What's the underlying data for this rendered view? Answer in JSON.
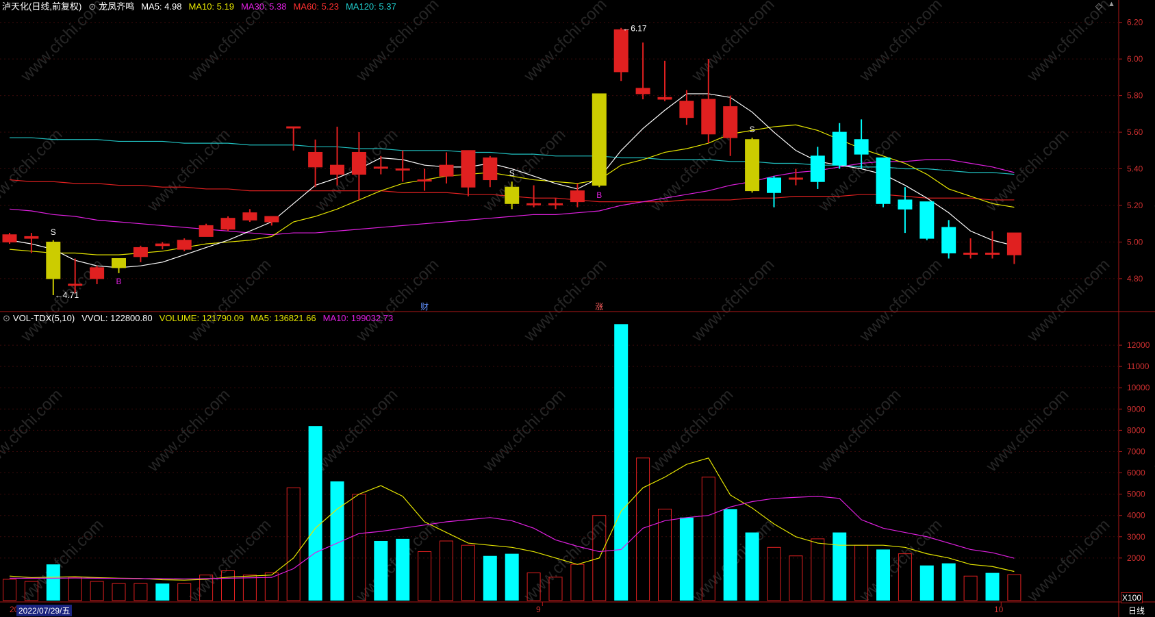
{
  "header": {
    "stock": "泸天化(日线,前复权)",
    "concept_icon": "circle-dot-icon",
    "concept": "龙凤齐鸣",
    "ma5": "MA5: 4.98",
    "ma10": "MA10: 5.19",
    "ma30": "MA30: 5.38",
    "ma60": "MA60: 5.23",
    "ma120": "MA120: 5.37"
  },
  "vol_header": {
    "name": "VOL-TDX(5,10)",
    "vvol": "VVOL: 122800.80",
    "volume": "VOLUME: 121790.09",
    "ma5": "MA5: 136821.66",
    "ma10": "MA10: 199032.73"
  },
  "footer": {
    "date_prefix": "20",
    "cursor_date": "2022/07/29/五",
    "month_9": "9",
    "month_10": "10",
    "period": "日线",
    "unit": "X100"
  },
  "watermark": "www.cfchi.com",
  "colors": {
    "up": "#e02020",
    "down": "#00ffff",
    "signal": "#cccc00",
    "ma5": "#ffffff",
    "ma10": "#e6e600",
    "ma30": "#e020e0",
    "ma60": "#e02020",
    "ma120": "#20c0c0",
    "axis": "#b01818"
  },
  "chart_data": [
    {
      "type": "candlestick",
      "title": "泸天化(日线,前复权)",
      "ylim": [
        4.62,
        6.24
      ],
      "yticks": [
        "6.20",
        "6.00",
        "5.80",
        "5.60",
        "5.40",
        "5.20",
        "5.00",
        "4.80"
      ],
      "candles": [
        {
          "o": 5.0,
          "c": 5.04,
          "h": 5.05,
          "l": 4.99
        },
        {
          "o": 5.02,
          "c": 5.03,
          "h": 5.05,
          "l": 4.94
        },
        {
          "o": 5.0,
          "c": 4.8,
          "h": 5.01,
          "l": 4.71,
          "hl": "signal"
        },
        {
          "o": 4.77,
          "c": 4.77,
          "h": 4.91,
          "l": 4.72
        },
        {
          "o": 4.8,
          "c": 4.86,
          "h": 4.87,
          "l": 4.77
        },
        {
          "o": 4.86,
          "c": 4.91,
          "h": 4.91,
          "l": 4.83,
          "hl": "signal"
        },
        {
          "o": 4.92,
          "c": 4.97,
          "h": 4.98,
          "l": 4.89
        },
        {
          "o": 4.98,
          "c": 4.99,
          "h": 5.0,
          "l": 4.96
        },
        {
          "o": 4.96,
          "c": 5.01,
          "h": 5.02,
          "l": 4.95
        },
        {
          "o": 5.03,
          "c": 5.09,
          "h": 5.1,
          "l": 5.03
        },
        {
          "o": 5.07,
          "c": 5.13,
          "h": 5.14,
          "l": 5.06
        },
        {
          "o": 5.12,
          "c": 5.16,
          "h": 5.18,
          "l": 5.11
        },
        {
          "o": 5.11,
          "c": 5.14,
          "h": 5.14,
          "l": 5.09
        },
        {
          "o": 5.63,
          "c": 5.63,
          "h": 5.63,
          "l": 5.5
        },
        {
          "o": 5.41,
          "c": 5.49,
          "h": 5.56,
          "l": 5.3
        },
        {
          "o": 5.37,
          "c": 5.42,
          "h": 5.63,
          "l": 5.31
        },
        {
          "o": 5.37,
          "c": 5.49,
          "h": 5.6,
          "l": 5.23
        },
        {
          "o": 5.41,
          "c": 5.41,
          "h": 5.47,
          "l": 5.37
        },
        {
          "o": 5.4,
          "c": 5.4,
          "h": 5.5,
          "l": 5.33
        },
        {
          "o": 5.34,
          "c": 5.34,
          "h": 5.4,
          "l": 5.28
        },
        {
          "o": 5.36,
          "c": 5.42,
          "h": 5.49,
          "l": 5.32
        },
        {
          "o": 5.3,
          "c": 5.5,
          "h": 5.5,
          "l": 5.25
        },
        {
          "o": 5.34,
          "c": 5.46,
          "h": 5.47,
          "l": 5.3
        },
        {
          "o": 5.3,
          "c": 5.21,
          "h": 5.33,
          "l": 5.18,
          "hl": "signal"
        },
        {
          "o": 5.21,
          "c": 5.21,
          "h": 5.31,
          "l": 5.19
        },
        {
          "o": 5.21,
          "c": 5.21,
          "h": 5.24,
          "l": 5.18
        },
        {
          "o": 5.22,
          "c": 5.28,
          "h": 5.32,
          "l": 5.19
        },
        {
          "o": 5.31,
          "c": 5.81,
          "h": 5.81,
          "l": 5.3,
          "hl": "signal"
        },
        {
          "o": 5.93,
          "c": 6.16,
          "h": 6.17,
          "l": 5.88
        },
        {
          "o": 5.81,
          "c": 5.84,
          "h": 6.09,
          "l": 5.78
        },
        {
          "o": 5.78,
          "c": 5.79,
          "h": 5.99,
          "l": 5.77
        },
        {
          "o": 5.68,
          "c": 5.77,
          "h": 5.83,
          "l": 5.64
        },
        {
          "o": 5.59,
          "c": 5.78,
          "h": 6.0,
          "l": 5.54
        },
        {
          "o": 5.57,
          "c": 5.74,
          "h": 5.8,
          "l": 5.47
        },
        {
          "o": 5.56,
          "c": 5.28,
          "h": 5.57,
          "l": 5.27,
          "hl": "signal"
        },
        {
          "o": 5.35,
          "c": 5.27,
          "h": 5.36,
          "l": 5.19
        },
        {
          "o": 5.35,
          "c": 5.35,
          "h": 5.4,
          "l": 5.31
        },
        {
          "o": 5.47,
          "c": 5.33,
          "h": 5.52,
          "l": 5.29
        },
        {
          "o": 5.6,
          "c": 5.42,
          "h": 5.65,
          "l": 5.4
        },
        {
          "o": 5.56,
          "c": 5.48,
          "h": 5.67,
          "l": 5.4
        },
        {
          "o": 5.46,
          "c": 5.21,
          "h": 5.46,
          "l": 5.19
        },
        {
          "o": 5.23,
          "c": 5.18,
          "h": 5.3,
          "l": 5.05
        },
        {
          "o": 5.22,
          "c": 5.02,
          "h": 5.22,
          "l": 5.01
        },
        {
          "o": 5.08,
          "c": 4.94,
          "h": 5.12,
          "l": 4.91
        },
        {
          "o": 4.94,
          "c": 4.94,
          "h": 5.02,
          "l": 4.91
        },
        {
          "o": 4.94,
          "c": 4.94,
          "h": 5.06,
          "l": 4.91
        },
        {
          "o": 4.93,
          "c": 5.05,
          "h": 5.05,
          "l": 4.88
        }
      ],
      "ma5": [
        5.01,
        4.99,
        4.96,
        4.9,
        4.87,
        4.86,
        4.87,
        4.89,
        4.93,
        4.97,
        5.01,
        5.06,
        5.11,
        5.21,
        5.31,
        5.35,
        5.4,
        5.46,
        5.45,
        5.42,
        5.41,
        5.41,
        5.43,
        5.4,
        5.36,
        5.32,
        5.29,
        5.35,
        5.5,
        5.62,
        5.72,
        5.81,
        5.81,
        5.79,
        5.71,
        5.6,
        5.5,
        5.44,
        5.42,
        5.4,
        5.37,
        5.31,
        5.24,
        5.16,
        5.06,
        5.01,
        4.98
      ],
      "ma10": [
        4.96,
        4.95,
        4.94,
        4.94,
        4.93,
        4.93,
        4.94,
        4.95,
        4.97,
        4.99,
        5.0,
        5.01,
        5.03,
        5.11,
        5.14,
        5.18,
        5.23,
        5.28,
        5.32,
        5.34,
        5.36,
        5.37,
        5.38,
        5.36,
        5.34,
        5.33,
        5.32,
        5.34,
        5.42,
        5.45,
        5.49,
        5.51,
        5.54,
        5.59,
        5.61,
        5.63,
        5.64,
        5.61,
        5.56,
        5.51,
        5.47,
        5.43,
        5.37,
        5.29,
        5.25,
        5.21,
        5.19
      ],
      "ma30": [
        5.18,
        5.17,
        5.15,
        5.14,
        5.12,
        5.11,
        5.1,
        5.09,
        5.08,
        5.07,
        5.06,
        5.05,
        5.04,
        5.05,
        5.05,
        5.06,
        5.07,
        5.08,
        5.09,
        5.1,
        5.11,
        5.12,
        5.13,
        5.14,
        5.15,
        5.15,
        5.16,
        5.17,
        5.2,
        5.22,
        5.24,
        5.26,
        5.28,
        5.31,
        5.33,
        5.36,
        5.38,
        5.39,
        5.41,
        5.43,
        5.44,
        5.44,
        5.45,
        5.45,
        5.43,
        5.41,
        5.38
      ],
      "ma60": [
        5.34,
        5.33,
        5.33,
        5.32,
        5.32,
        5.31,
        5.31,
        5.3,
        5.3,
        5.29,
        5.29,
        5.28,
        5.28,
        5.28,
        5.28,
        5.28,
        5.28,
        5.28,
        5.27,
        5.27,
        5.27,
        5.26,
        5.26,
        5.25,
        5.24,
        5.24,
        5.23,
        5.22,
        5.22,
        5.22,
        5.22,
        5.23,
        5.23,
        5.23,
        5.24,
        5.24,
        5.25,
        5.25,
        5.25,
        5.26,
        5.26,
        5.25,
        5.24,
        5.24,
        5.24,
        5.23,
        5.23
      ],
      "ma120": [
        5.57,
        5.57,
        5.56,
        5.56,
        5.56,
        5.55,
        5.55,
        5.55,
        5.54,
        5.54,
        5.54,
        5.53,
        5.53,
        5.53,
        5.52,
        5.52,
        5.51,
        5.51,
        5.5,
        5.5,
        5.5,
        5.49,
        5.49,
        5.48,
        5.48,
        5.47,
        5.47,
        5.47,
        5.46,
        5.46,
        5.45,
        5.45,
        5.45,
        5.44,
        5.44,
        5.43,
        5.43,
        5.42,
        5.42,
        5.41,
        5.41,
        5.4,
        5.4,
        5.39,
        5.38,
        5.38,
        5.37
      ],
      "annotations": [
        {
          "i": 2,
          "text": "S",
          "pos": "above"
        },
        {
          "i": 5,
          "text": "B",
          "pos": "below"
        },
        {
          "i": 23,
          "text": "S",
          "pos": "above"
        },
        {
          "i": 27,
          "text": "B",
          "pos": "below"
        },
        {
          "i": 34,
          "text": "S",
          "pos": "above"
        },
        {
          "i": 2,
          "text": "←4.71",
          "pos": "low"
        },
        {
          "i": 28,
          "text": "←6.17",
          "pos": "high"
        }
      ],
      "markers": [
        {
          "i": 19,
          "text": "财"
        },
        {
          "i": 27,
          "text": "涨"
        }
      ]
    },
    {
      "type": "bar",
      "title": "VOL-TDX(5,10)",
      "unit": "X100",
      "ylim": [
        0,
        13000
      ],
      "yticks": [
        "12000",
        "11000",
        "10000",
        "9000",
        "8000",
        "7000",
        "6000",
        "5000",
        "4000",
        "3000",
        "2000"
      ],
      "series": [
        {
          "name": "VOLUME",
          "values": [
            1000,
            900,
            1700,
            1100,
            900,
            800,
            800,
            800,
            800,
            1200,
            1400,
            1200,
            1300,
            5300,
            8200,
            5600,
            5000,
            2800,
            2900,
            2300,
            2800,
            2600,
            2100,
            2200,
            1300,
            1100,
            1700,
            4000,
            12990,
            6700,
            4300,
            3900,
            5800,
            4300,
            3200,
            2500,
            2100,
            2900,
            3200,
            2600,
            2400,
            2200,
            1650,
            1750,
            1150,
            1300,
            1218
          ]
        },
        {
          "name": "MA5",
          "values": [
            1150,
            1080,
            1100,
            1120,
            1080,
            1050,
            1040,
            980,
            960,
            1000,
            1100,
            1150,
            1200,
            2000,
            3400,
            4300,
            5000,
            5400,
            4900,
            3700,
            3200,
            2700,
            2600,
            2500,
            2300,
            2000,
            1700,
            2000,
            4200,
            5300,
            5800,
            6400,
            6700,
            4960,
            4350,
            3600,
            3000,
            2700,
            2600,
            2600,
            2600,
            2500,
            2200,
            2000,
            1700,
            1600,
            1368
          ]
        },
        {
          "name": "MA10",
          "values": [
            1050,
            1050,
            1050,
            1060,
            1050,
            1040,
            1030,
            1030,
            1020,
            1030,
            1050,
            1070,
            1090,
            1500,
            2250,
            2700,
            3150,
            3250,
            3400,
            3550,
            3700,
            3800,
            3900,
            3750,
            3400,
            2850,
            2550,
            2300,
            2400,
            3400,
            3750,
            3900,
            4000,
            4400,
            4650,
            4800,
            4850,
            4900,
            4800,
            3800,
            3400,
            3200,
            3000,
            2700,
            2400,
            2250,
            1990
          ]
        }
      ],
      "up_days": [
        0,
        1,
        3,
        4,
        5,
        6,
        8,
        9,
        10,
        11,
        12,
        13,
        16,
        19,
        20,
        21,
        24,
        25,
        26,
        27,
        29,
        30,
        32,
        35,
        36,
        37,
        39,
        41,
        44,
        46
      ],
      "annotations_vol": [
        {
          "i": 1,
          "text": "VOL"
        }
      ]
    }
  ]
}
